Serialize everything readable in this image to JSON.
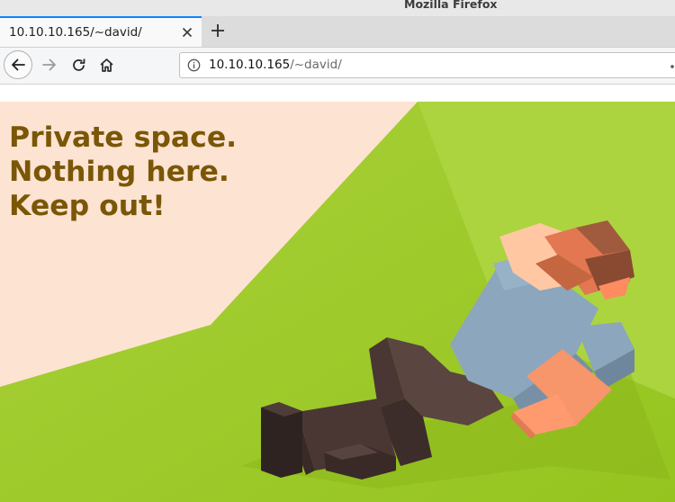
{
  "window": {
    "title": "Mozilla Firefox"
  },
  "tabs": [
    {
      "label": "10.10.10.165/~david/",
      "active": true
    }
  ],
  "toolbar": {
    "url_host": "10.10.10.165",
    "url_path": "/~david/"
  },
  "page": {
    "headline_lines": [
      "Private space.",
      "Nothing here.",
      "Keep out!"
    ],
    "colors": {
      "headline": "#7a5706",
      "background_light": "#fde3d2",
      "grass": "#9ecb2c"
    }
  },
  "icons": {
    "back": "back-arrow-icon",
    "forward": "forward-arrow-icon",
    "reload": "reload-icon",
    "home": "home-icon",
    "site_info": "info-icon",
    "close_tab": "close-icon",
    "new_tab": "plus-icon"
  }
}
